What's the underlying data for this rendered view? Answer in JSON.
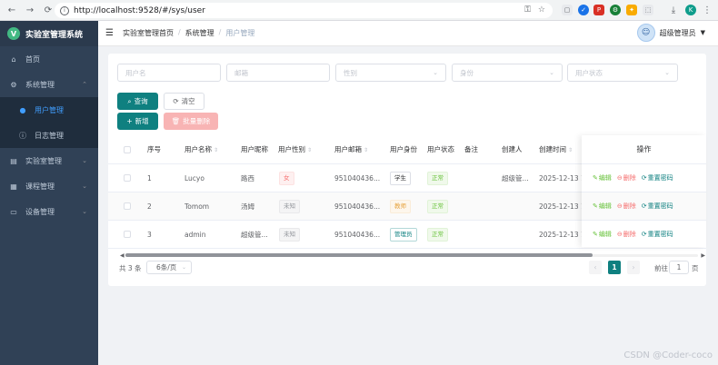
{
  "browser": {
    "url": "http://localhost:9528/#/sys/user",
    "profile_initial": "K"
  },
  "app": {
    "logo_letter": "V",
    "title": "实验室管理系统"
  },
  "sidebar": {
    "items": [
      {
        "label": "首页"
      },
      {
        "label": "系统管理"
      },
      {
        "label": "用户管理"
      },
      {
        "label": "日志管理"
      },
      {
        "label": "实验室管理"
      },
      {
        "label": "课程管理"
      },
      {
        "label": "设备管理"
      }
    ]
  },
  "header": {
    "breadcrumb": [
      "实验室管理首页",
      "系统管理",
      "用户管理"
    ],
    "username": "超级管理员"
  },
  "filters": {
    "username": "用户名",
    "email": "邮箱",
    "gender": "性别",
    "role": "身份",
    "status": "用户状态"
  },
  "buttons": {
    "search": "查询",
    "clear": "清空",
    "add": "新增",
    "batch_delete": "批量删除"
  },
  "table": {
    "headers": [
      "序号",
      "用户名称",
      "用户昵称",
      "用户性别",
      "用户邮箱",
      "用户身份",
      "用户状态",
      "备注",
      "创建人",
      "创建时间",
      "操作"
    ],
    "rows": [
      {
        "index": "1",
        "name": "Lucyo",
        "nickname": "路西",
        "gender": "女",
        "email": "951040436...",
        "role": "学生",
        "status": "正常",
        "remark": "",
        "creator": "超级管...",
        "created": "2025-12-13 1..."
      },
      {
        "index": "2",
        "name": "Tomom",
        "nickname": "汤姆",
        "gender": "未知",
        "email": "951040436...",
        "role": "教师",
        "status": "正常",
        "remark": "",
        "creator": "",
        "created": "2025-12-13 1..."
      },
      {
        "index": "3",
        "name": "admin",
        "nickname": "超级管...",
        "gender": "未知",
        "email": "951040436...",
        "role": "管理员",
        "status": "正常",
        "remark": "",
        "creator": "",
        "created": "2025-12-13 1..."
      }
    ],
    "ops": {
      "edit": "编辑",
      "delete": "删除",
      "reset": "重置密码"
    }
  },
  "pager": {
    "total": "共 3 条",
    "page_size": "6条/页",
    "current": "1",
    "goto_prefix": "前往",
    "goto_value": "1",
    "goto_suffix": "页"
  },
  "watermark": "CSDN @Coder-coco"
}
